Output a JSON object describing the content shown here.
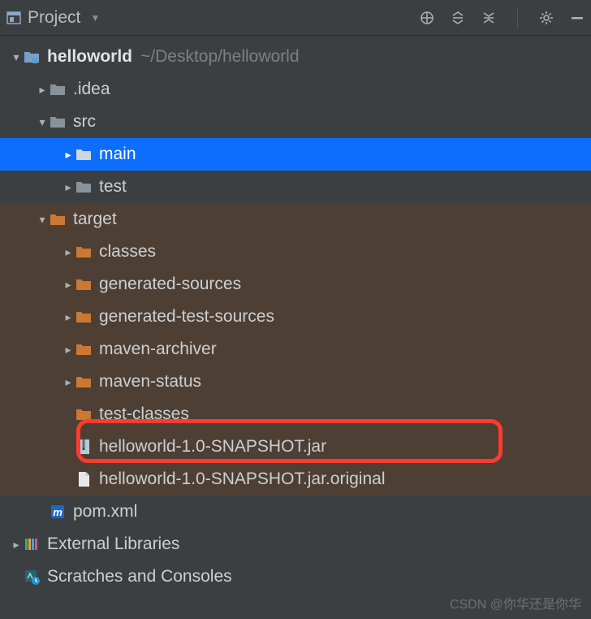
{
  "toolbar": {
    "title": "Project"
  },
  "root": {
    "name": "helloworld",
    "path": "~/Desktop/helloworld"
  },
  "idea": {
    "name": ".idea"
  },
  "src": {
    "name": "src"
  },
  "main": {
    "name": "main"
  },
  "test": {
    "name": "test"
  },
  "target": {
    "name": "target"
  },
  "targetChildren": {
    "classes": "classes",
    "gensrc": "generated-sources",
    "gentest": "generated-test-sources",
    "marchiver": "maven-archiver",
    "mstatus": "maven-status",
    "testcls": "test-classes",
    "jar": "helloworld-1.0-SNAPSHOT.jar",
    "jarorig": "helloworld-1.0-SNAPSHOT.jar.original"
  },
  "pom": {
    "name": "pom.xml"
  },
  "extlib": {
    "name": "External Libraries"
  },
  "scratches": {
    "name": "Scratches and Consoles"
  },
  "watermark": "CSDN @你华还是你华"
}
